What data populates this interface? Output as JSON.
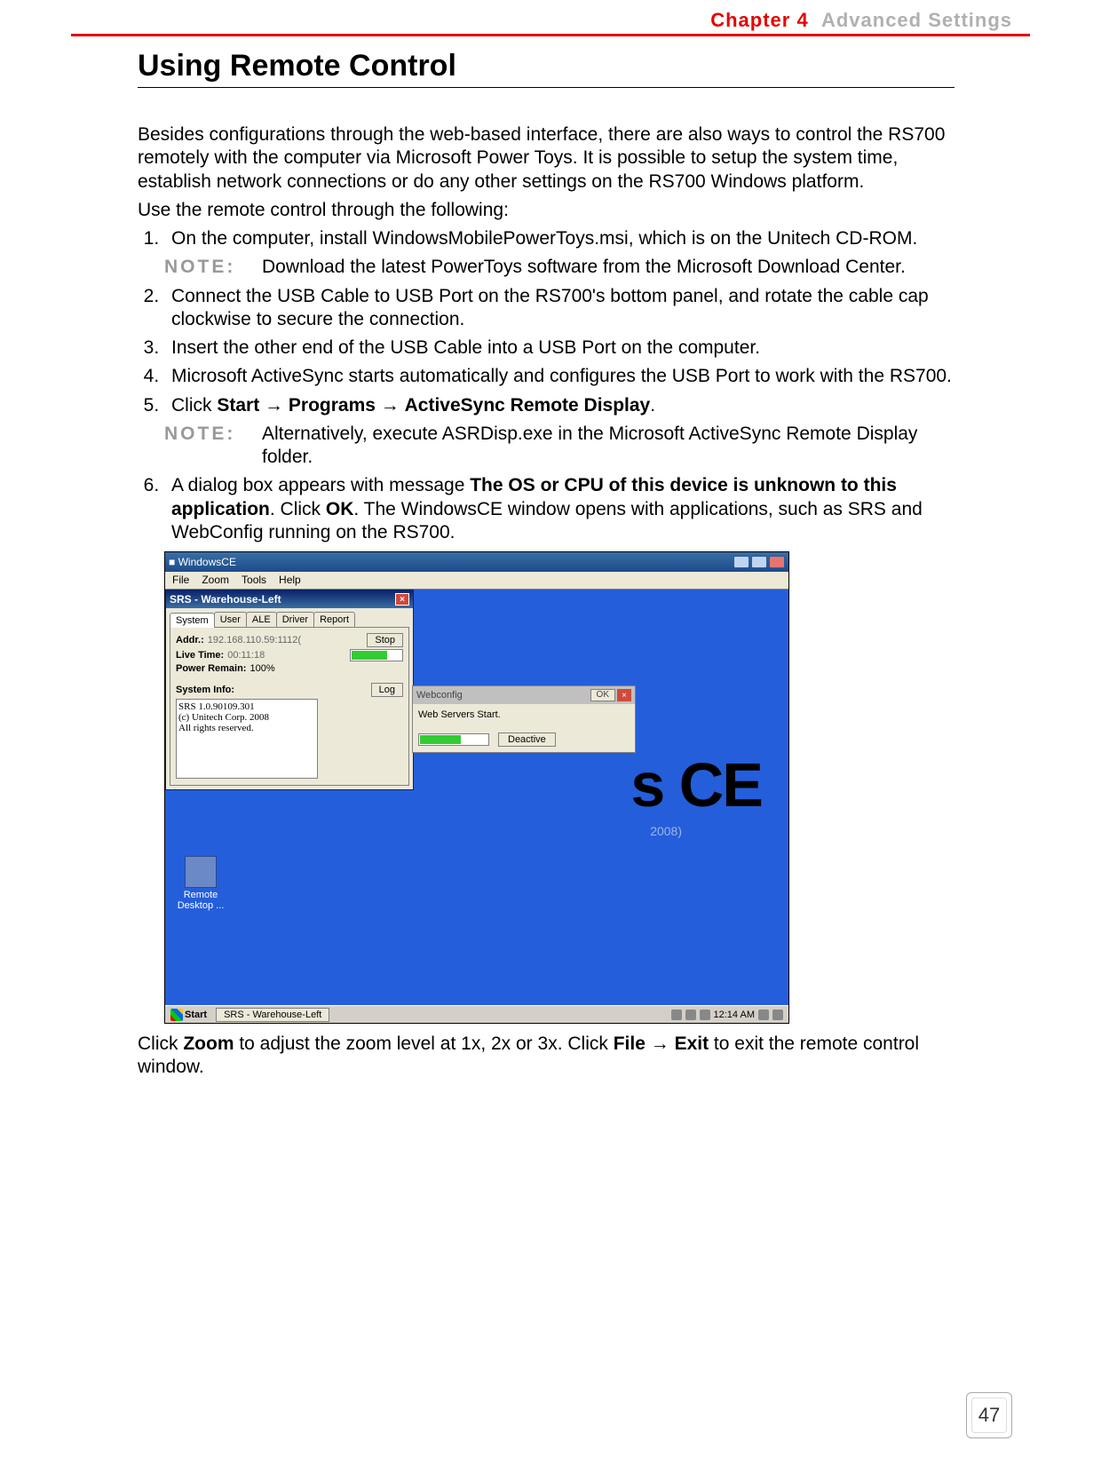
{
  "header": {
    "chapter": "Chapter 4",
    "section": "Advanced Settings"
  },
  "title": "Using Remote Control",
  "intro1": "Besides configurations through the web-based interface, there are also ways to control the RS700 remotely with the computer via Microsoft Power Toys. It is possible to setup the system time, establish network connections or do any other settings on the RS700 Windows platform.",
  "intro2": "Use the remote control through the following:",
  "steps": {
    "s1": "On the computer, install WindowsMobilePowerToys.msi, which is on the Unitech CD-ROM.",
    "note1_label": "NOTE:",
    "note1": "Download the latest PowerToys software from the Microsoft Download Center.",
    "s2": "Connect the USB Cable to USB Port on the RS700's bottom panel, and rotate the cable cap clockwise to secure the connection.",
    "s3": "Insert the other end of the USB Cable into a USB Port on the computer.",
    "s4": "Microsoft ActiveSync starts automatically and configures the USB Port to work with the RS700.",
    "s5_pre": "Click ",
    "s5_b1": "Start",
    "s5_b2": "Programs",
    "s5_b3": "ActiveSync Remote Display",
    "note2_label": "NOTE:",
    "note2": "Alternatively, execute ASRDisp.exe in the Microsoft ActiveSync Remote Display folder.",
    "s6_pre": "A dialog box appears with message ",
    "s6_b1": "The OS or CPU of this device is unknown to this application",
    "s6_mid": ". Click ",
    "s6_b2": "OK",
    "s6_post": ". The WindowsCE window opens with applications, such as SRS and WebConfig running on the RS700."
  },
  "shot": {
    "outer_title": "WindowsCE",
    "menu": [
      "File",
      "Zoom",
      "Tools",
      "Help"
    ],
    "bg_text": "s CE",
    "bg_year": "2008)",
    "desktop_icon": "Remote Desktop ...",
    "taskbar": {
      "start": "Start",
      "task": "SRS - Warehouse-Left",
      "time": "12:14 AM"
    },
    "srs": {
      "title": "SRS - Warehouse-Left",
      "tabs": [
        "System",
        "User",
        "ALE",
        "Driver",
        "Report"
      ],
      "addr_label": "Addr.:",
      "addr_val": "192.168.110.59:1112(",
      "stop": "Stop",
      "live_label": "Live Time:",
      "live_val": "00:11:18",
      "power_label": "Power Remain:",
      "power_val": "100%",
      "log": "Log",
      "sys_label": "System Info:",
      "sys_text": "SRS 1.0.90109.301\n(c) Unitech Corp. 2008\nAll rights reserved."
    },
    "webc": {
      "title": "Webconfig",
      "ok": "OK",
      "msg": "Web Servers Start.",
      "deactive": "Deactive"
    }
  },
  "outro_pre": "Click ",
  "outro_b1": "Zoom",
  "outro_mid1": " to adjust the zoom level at 1x, 2x or 3x. Click ",
  "outro_b2": "File",
  "outro_b3": "Exit",
  "outro_post": " to exit the remote control window.",
  "page": "47"
}
